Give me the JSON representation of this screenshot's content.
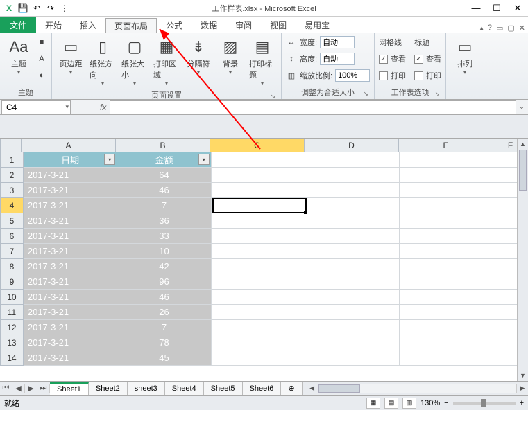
{
  "title": "工作样表.xlsx - Microsoft Excel",
  "qat": {
    "excel": "X",
    "save": "💾",
    "undo": "↶",
    "redo": "↷",
    "more": "⋮"
  },
  "win": {
    "min": "—",
    "max": "☐",
    "close": "✕"
  },
  "tabs": {
    "file": "文件",
    "items": [
      "开始",
      "插入",
      "页面布局",
      "公式",
      "数据",
      "审阅",
      "视图",
      "易用宝"
    ],
    "active": 2,
    "help": {
      "caret": "▴",
      "q": "?",
      "r1": "▭",
      "r2": "▢",
      "x": "✕"
    }
  },
  "ribbon": {
    "g1": {
      "label": "主题",
      "themes": {
        "icon": "Aa",
        "label": "主题",
        "drop": "▾"
      },
      "mini": [
        "■",
        "A",
        "◐"
      ]
    },
    "g2": {
      "label": "页面设置",
      "btns": [
        {
          "icon": "▭",
          "label": "页边距"
        },
        {
          "icon": "▯",
          "label": "纸张方向"
        },
        {
          "icon": "▢",
          "label": "纸张大小"
        },
        {
          "icon": "▦",
          "label": "打印区域"
        },
        {
          "icon": "⇟",
          "label": "分隔符"
        },
        {
          "icon": "▨",
          "label": "背景"
        },
        {
          "icon": "▤",
          "label": "打印标题"
        }
      ]
    },
    "g3": {
      "label": "调整为合适大小",
      "width": {
        "icon": "↔",
        "label": "宽度:",
        "value": "自动"
      },
      "height": {
        "icon": "↕",
        "label": "高度:",
        "value": "自动"
      },
      "scale": {
        "icon": "▥",
        "label": "缩放比例:",
        "value": "100%"
      }
    },
    "g4": {
      "label": "工作表选项",
      "grid": {
        "title": "网格线",
        "view": "查看",
        "print": "打印",
        "viewchk": true,
        "printchk": false
      },
      "head": {
        "title": "标题",
        "view": "查看",
        "print": "打印",
        "viewchk": true,
        "printchk": false
      }
    },
    "g5": {
      "icon": "▭",
      "label": "排列",
      "drop": "▾"
    }
  },
  "namebox": "C4",
  "fx": "fx",
  "cols": [
    "A",
    "B",
    "C",
    "D",
    "E",
    "F"
  ],
  "colSel": 2,
  "rowSel": 4,
  "header": {
    "a": "日期",
    "b": "金额"
  },
  "rowsData": [
    {
      "d": "2017-3-21",
      "v": "64"
    },
    {
      "d": "2017-3-21",
      "v": "46"
    },
    {
      "d": "2017-3-21",
      "v": "7"
    },
    {
      "d": "2017-3-21",
      "v": "36"
    },
    {
      "d": "2017-3-21",
      "v": "33"
    },
    {
      "d": "2017-3-21",
      "v": "10"
    },
    {
      "d": "2017-3-21",
      "v": "42"
    },
    {
      "d": "2017-3-21",
      "v": "96"
    },
    {
      "d": "2017-3-21",
      "v": "46"
    },
    {
      "d": "2017-3-21",
      "v": "26"
    },
    {
      "d": "2017-3-21",
      "v": "7"
    },
    {
      "d": "2017-3-21",
      "v": "78"
    },
    {
      "d": "2017-3-21",
      "v": "45"
    }
  ],
  "sheets": [
    "Sheet1",
    "Sheet2",
    "sheet3",
    "Sheet4",
    "Sheet5",
    "Sheet6"
  ],
  "sheetNewIcon": "⊕",
  "status": {
    "ready": "就绪",
    "zoom": "130%",
    "minus": "−",
    "plus": "+"
  }
}
